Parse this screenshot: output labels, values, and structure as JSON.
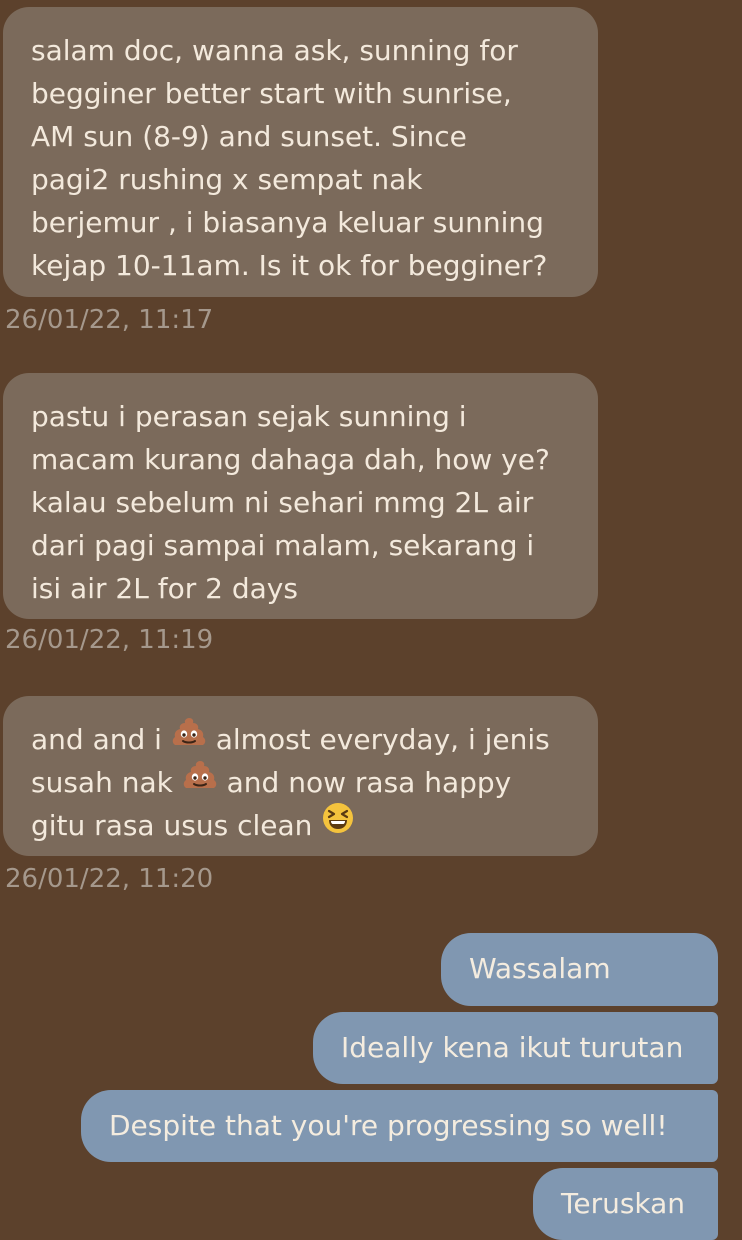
{
  "messages": [
    {
      "direction": "incoming",
      "lines": [
        "salam doc, wanna ask, sunning for",
        "begginer better start with sunrise,",
        "AM sun (8-9) and sunset. Since",
        "pagi2 rushing x sempat nak",
        "berjemur , i biasanya keluar sunning",
        "kejap 10-11am. Is it ok for begginer?"
      ],
      "timestamp": "26/01/22, 11:17"
    },
    {
      "direction": "incoming",
      "lines": [
        "pastu i perasan sejak sunning i",
        "macam kurang dahaga dah, how ye?",
        "kalau sebelum ni sehari mmg 2L air",
        "dari pagi sampai malam, sekarang i",
        "isi air 2L for 2 days"
      ],
      "timestamp": "26/01/22, 11:19"
    },
    {
      "direction": "incoming",
      "segments": {
        "line1_a": "and and i ",
        "line1_b": " almost everyday, i jenis",
        "line2_a": "susah nak ",
        "line2_b": " and now rasa happy",
        "line3_a": "gitu rasa usus clean "
      },
      "emoji_icons": [
        "poop-emoji",
        "poop-emoji",
        "laughing-emoji"
      ],
      "timestamp": "26/01/22, 11:20"
    },
    {
      "direction": "outgoing",
      "text": "Wassalam"
    },
    {
      "direction": "outgoing",
      "text": "Ideally kena ikut turutan"
    },
    {
      "direction": "outgoing",
      "text": "Despite that you're progressing so well!"
    },
    {
      "direction": "outgoing",
      "text": "Teruskan"
    }
  ],
  "colors": {
    "background": "#5c412c",
    "incoming_bubble": "#7b6a5b",
    "outgoing_bubble": "#8097b1",
    "timestamp": "#a5988c"
  }
}
